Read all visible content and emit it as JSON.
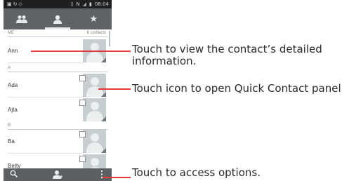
{
  "status_bar": {
    "left_icons": [
      "image-icon",
      "sync-icon",
      "wifi-icon"
    ],
    "right_icons": [
      "vibrate-icon",
      "nfc-icon",
      "signal-icon",
      "battery-icon"
    ],
    "time": "08:04"
  },
  "tabs": [
    {
      "icon": "group-icon",
      "selected": false
    },
    {
      "icon": "person-icon",
      "selected": true
    },
    {
      "icon": "star-icon",
      "selected": false
    }
  ],
  "me_section": {
    "label": "ME",
    "count": "6 contacts"
  },
  "contacts": [
    {
      "section": "",
      "name": "Ann"
    },
    {
      "section": "A",
      "name": "Ada"
    },
    {
      "section": "",
      "name": "Ajta"
    },
    {
      "section": "B",
      "name": "Ba"
    },
    {
      "section": "",
      "name": "Betty"
    }
  ],
  "bottom_bar": {
    "icons": [
      "search-icon",
      "add-contact-icon",
      "overflow-menu-icon"
    ]
  },
  "annotations": {
    "detail": "Touch to view the contact’s detailed information.",
    "detail_line1": "Touch to view the contact’s detailed",
    "detail_line2": "information.",
    "quick_contact": "Touch icon to open Quick Contact panel.",
    "options": "Touch to access options."
  },
  "colors": {
    "callout_line": "#e53a3a",
    "bar": "#5f6367"
  }
}
